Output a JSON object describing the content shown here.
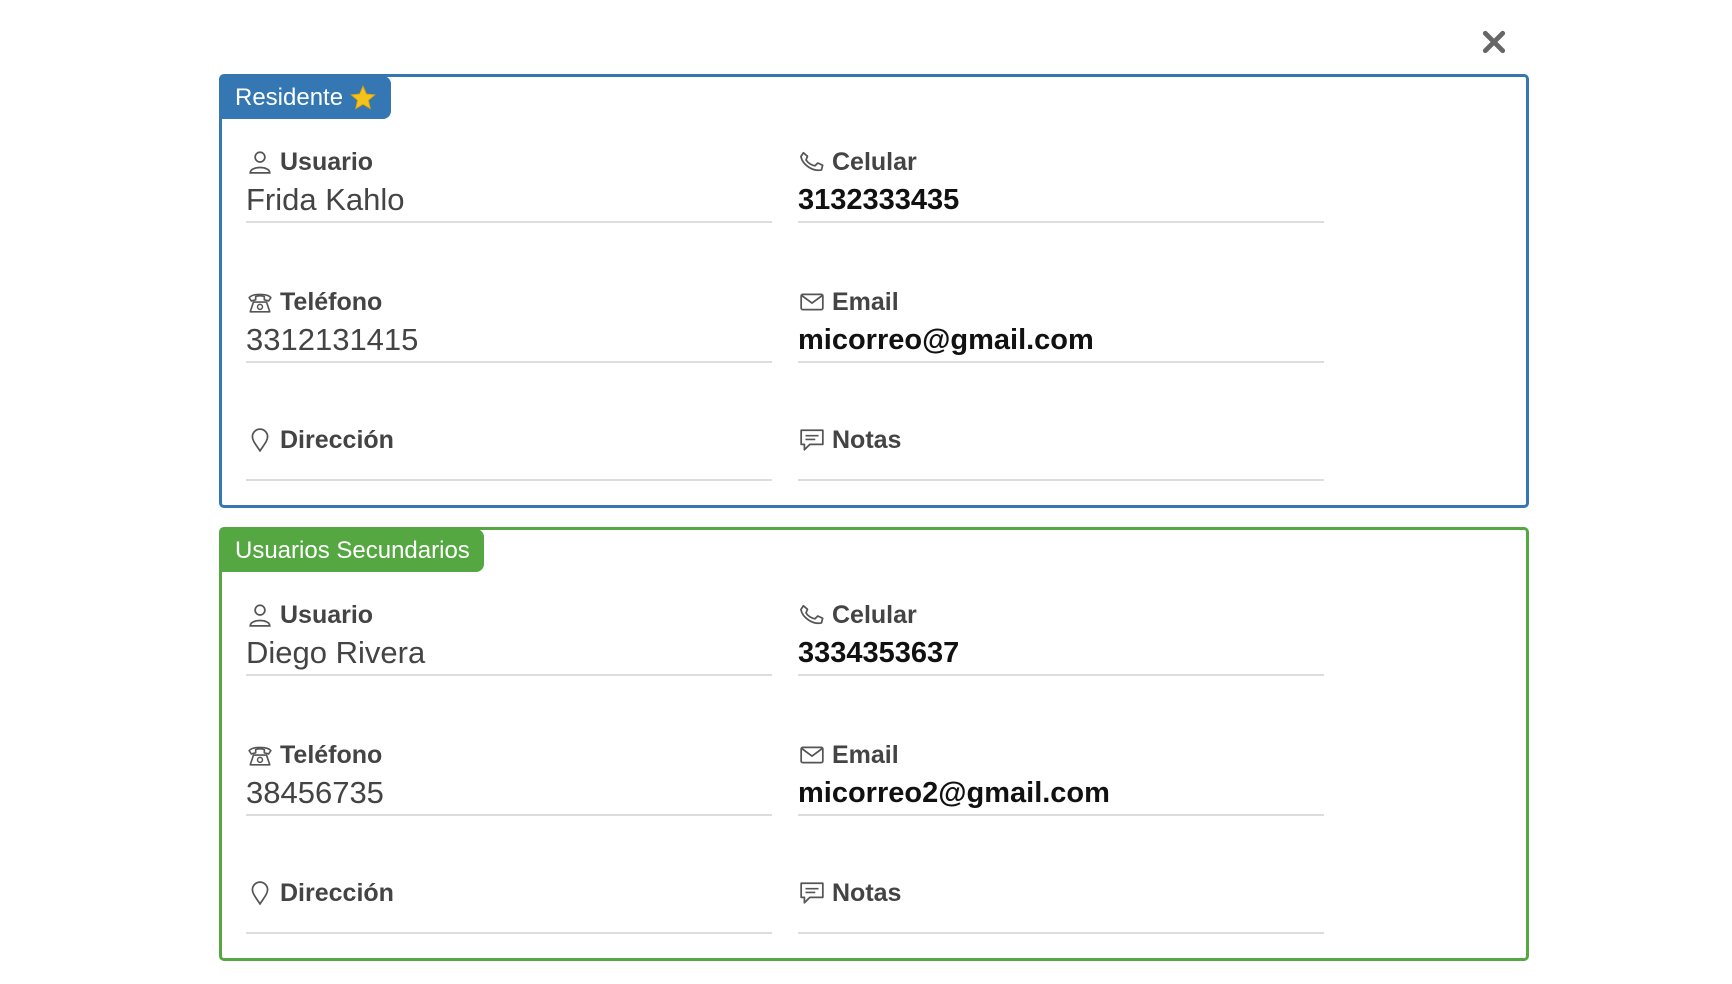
{
  "close": {
    "icon": "close-icon"
  },
  "resident": {
    "tag": "Residente",
    "tag_icon": "star-icon",
    "accent_color": "#3477b3",
    "fields": {
      "usuario": {
        "label": "Usuario",
        "icon": "user-icon",
        "value": "Frida Kahlo"
      },
      "celular": {
        "label": "Celular",
        "icon": "phone-handset-icon",
        "value": "3132333435"
      },
      "telefono": {
        "label": "Teléfono",
        "icon": "landline-phone-icon",
        "value": "3312131415"
      },
      "email": {
        "label": "Email",
        "icon": "envelope-icon",
        "value": "micorreo@gmail.com"
      },
      "direccion": {
        "label": "Dirección",
        "icon": "map-pin-icon",
        "value": ""
      },
      "notas": {
        "label": "Notas",
        "icon": "comment-icon",
        "value": ""
      }
    }
  },
  "secondary": {
    "tag": "Usuarios Secundarios",
    "accent_color": "#55a742",
    "fields": {
      "usuario": {
        "label": "Usuario",
        "icon": "user-icon",
        "value": "Diego Rivera"
      },
      "celular": {
        "label": "Celular",
        "icon": "phone-handset-icon",
        "value": "3334353637"
      },
      "telefono": {
        "label": "Teléfono",
        "icon": "landline-phone-icon",
        "value": "38456735"
      },
      "email": {
        "label": "Email",
        "icon": "envelope-icon",
        "value": "micorreo2@gmail.com"
      },
      "direccion": {
        "label": "Dirección",
        "icon": "map-pin-icon",
        "value": ""
      },
      "notas": {
        "label": "Notas",
        "icon": "comment-icon",
        "value": ""
      }
    }
  }
}
